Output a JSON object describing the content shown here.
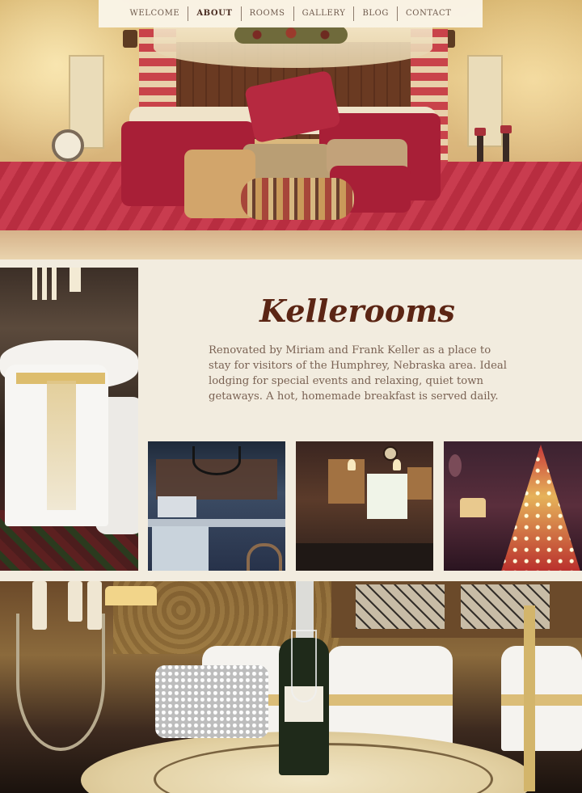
{
  "nav": {
    "items": [
      {
        "label": "WELCOME",
        "active": false
      },
      {
        "label": "ABOUT",
        "active": true
      },
      {
        "label": "ROOMS",
        "active": false
      },
      {
        "label": "GALLERY",
        "active": false
      },
      {
        "label": "BLOG",
        "active": false
      },
      {
        "label": "CONTACT",
        "active": false
      }
    ]
  },
  "about": {
    "title": "Kellerooms",
    "description": "Renovated by Miriam and Frank Keller as a place to stay for visitors of the Humphrey, Nebraska area. Ideal lodging for special events and relaxing, quiet town getaways. A hot, homemade breakfast is served daily."
  },
  "colors": {
    "title": "#5b2514",
    "body_text": "#7a6253",
    "nav_text": "#6e5a4c",
    "background": "#f2ecdf"
  }
}
